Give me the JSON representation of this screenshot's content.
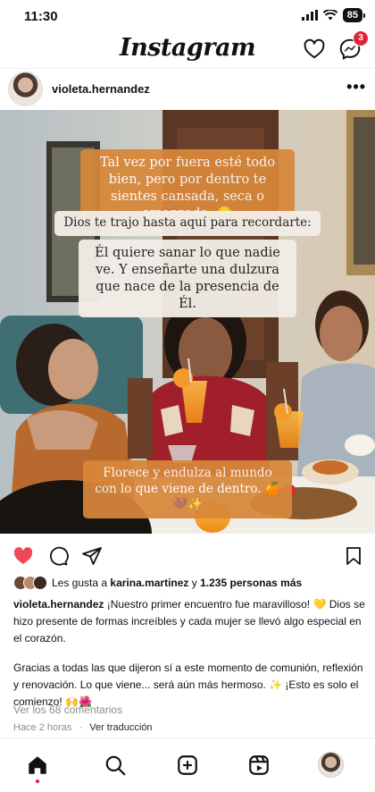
{
  "status": {
    "time": "11:30",
    "battery": "85"
  },
  "header": {
    "logo": "Instagram",
    "messages_badge": "3"
  },
  "post": {
    "username": "violeta.hernandez",
    "overlay": {
      "text1": "Tal vez por fuera esté todo bien, pero por dentro te sientes cansada, seca o amargada. 😞",
      "text2": "Dios te trajo hasta aquí para recordarte:",
      "text3": "Él quiere sanar lo que nadie ve. Y enseñarte una dulzura que nace de la presencia de Él.",
      "text4": "Florece y endulza al mundo con lo que viene de dentro. 🍊🤎✨"
    },
    "likes": {
      "prefix": "Les gusta a",
      "user": "karina.martinez",
      "middle": "y",
      "count": "1.235 personas más"
    },
    "caption": {
      "username": "violeta.hernandez",
      "text1": "¡Nuestro primer encuentro fue maravilloso! 💛 Dios se hizo presente de formas increíbles y cada mujer se llevó algo especial en el corazón.",
      "text2": "Gracias a todas las que dijeron sí a este momento de comunión, reflexión y renovación. Lo que viene... será aún más hermoso. ✨ ¡Esto es solo el comienzo! 🙌🌺"
    },
    "comments_link": "Ver los 68 comentarios",
    "time_ago": "Hace 2 horas",
    "separator": "·",
    "translate": "Ver traducción"
  },
  "icons": {
    "status": [
      "signal-icon",
      "wifi-icon",
      "battery-icon"
    ],
    "header": [
      "heart-icon",
      "messenger-icon"
    ],
    "actions": [
      "like-heart-icon",
      "comment-icon",
      "share-icon",
      "bookmark-icon"
    ],
    "nav": [
      "home-icon",
      "search-icon",
      "create-icon",
      "reels-icon",
      "profile-avatar"
    ]
  },
  "colors": {
    "like_red": "#ed4956",
    "badge_red": "#e0243a",
    "overlay_orange": "#d8873a",
    "overlay_white": "#f2ede6",
    "muted_gray": "#8e8e8e"
  }
}
